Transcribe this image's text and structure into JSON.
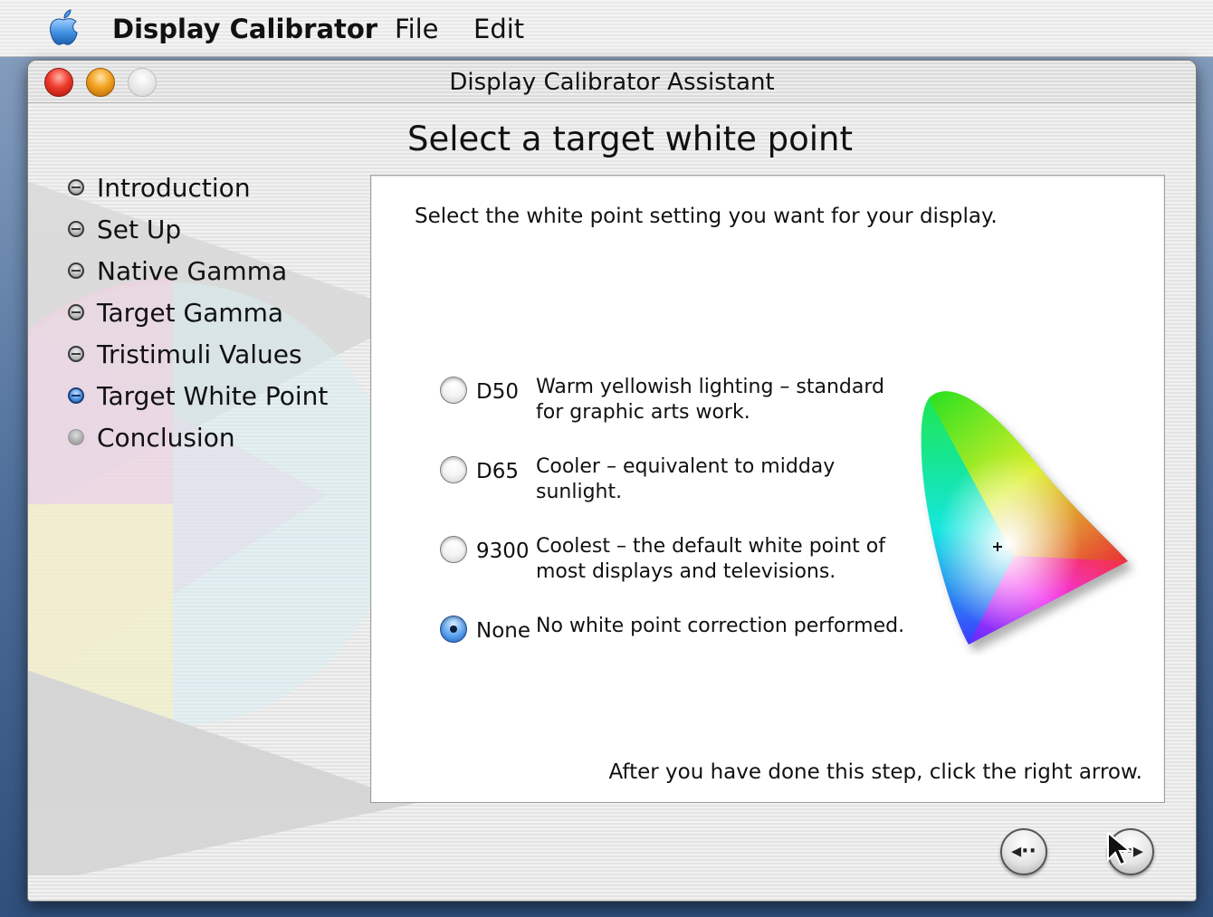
{
  "menubar": {
    "app_name": "Display Calibrator",
    "file_label": "File",
    "edit_label": "Edit",
    "apple_icon": "apple-logo-icon"
  },
  "window": {
    "title": "Display Calibrator Assistant",
    "controls": [
      "close-button",
      "minimize-button",
      "zoom-button"
    ]
  },
  "page": {
    "heading": "Select a target white point",
    "instruction": "Select the white point setting you want for your display.",
    "after_note": "After you have done this step, click the right arrow."
  },
  "steps": [
    {
      "label": "Introduction",
      "state": "done"
    },
    {
      "label": "Set Up",
      "state": "done"
    },
    {
      "label": "Native Gamma",
      "state": "done"
    },
    {
      "label": "Target Gamma",
      "state": "done"
    },
    {
      "label": "Tristimuli Values",
      "state": "done"
    },
    {
      "label": "Target White Point",
      "state": "current"
    },
    {
      "label": "Conclusion",
      "state": "pending"
    }
  ],
  "options": [
    {
      "name": "D50",
      "description": "Warm yellowish lighting – standard for graphic arts work.",
      "selected": false
    },
    {
      "name": "D65",
      "description": "Cooler – equivalent to midday sunlight.",
      "selected": false
    },
    {
      "name": "9300",
      "description": "Coolest – the default white point of most displays and televisions.",
      "selected": false
    },
    {
      "name": "None",
      "description": "No white point correction performed.",
      "selected": true
    }
  ],
  "nav": {
    "back_glyph": "◂··",
    "next_glyph": "··▸",
    "back_icon": "back-arrow-icon",
    "next_icon": "forward-arrow-icon"
  },
  "colors": {
    "accent": "#3b82d6",
    "close": "#e0392b",
    "minimize": "#f0a020"
  }
}
